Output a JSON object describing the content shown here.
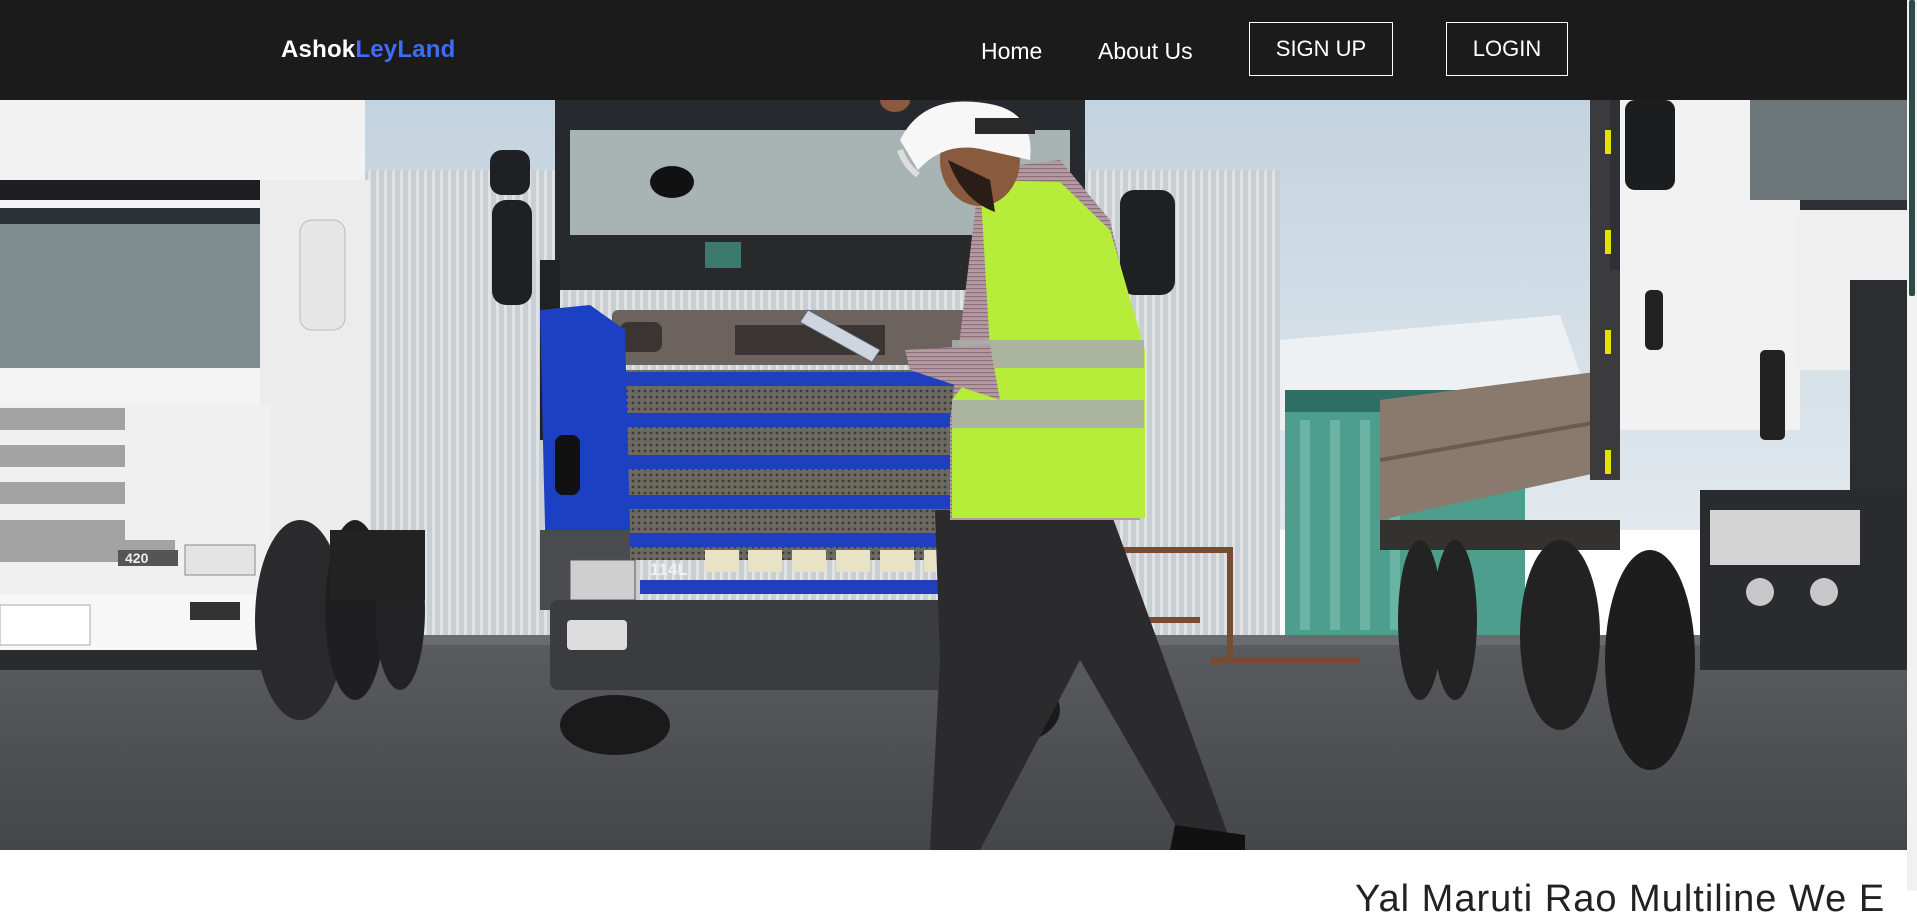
{
  "navbar": {
    "brand_part1": "Ashok",
    "brand_part2": "LeyLand",
    "links": {
      "home": "Home",
      "about": "About Us"
    },
    "buttons": {
      "signup": "SIGN UP",
      "login": "LOGIN"
    }
  },
  "hero": {
    "truck_badges": {
      "left_truck": "420",
      "center_truck": "114L"
    }
  },
  "section": {
    "heading": "Yal Maruti Rao Multiline We E"
  },
  "colors": {
    "navbar_bg": "#1c1b1c",
    "brand_accent": "#3b6ef5",
    "text_light": "#ffffff"
  }
}
